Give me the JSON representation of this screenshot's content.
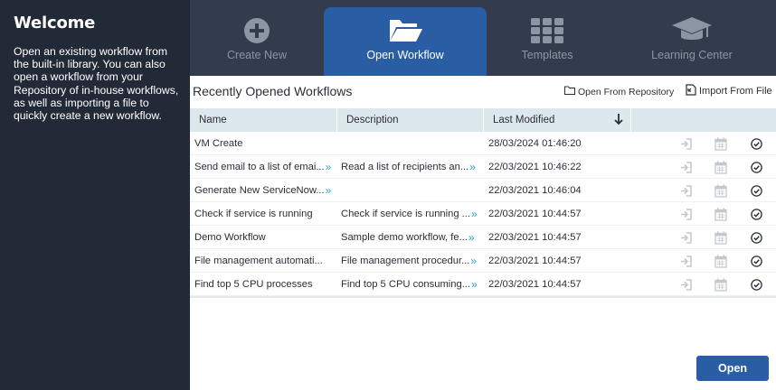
{
  "sidebar": {
    "title": "Welcome",
    "description": "Open an existing workflow from the built-in library. You can also open a workflow from your Repository of in-house workflows, as well as importing a file to quickly create a new workflow."
  },
  "tabs": [
    {
      "label": "Create New",
      "icon": "plus-circle-icon",
      "active": false
    },
    {
      "label": "Open Workflow",
      "icon": "folder-open-icon",
      "active": true
    },
    {
      "label": "Templates",
      "icon": "grid-icon",
      "active": false
    },
    {
      "label": "Learning Center",
      "icon": "graduation-cap-icon",
      "active": false
    }
  ],
  "main": {
    "heading": "Recently Opened Workflows",
    "open_from_repository": "Open From Repository",
    "import_from_file": "Import From File",
    "columns": {
      "name": "Name",
      "description": "Description",
      "last_modified": "Last Modified"
    },
    "rows": [
      {
        "name": "VM Create",
        "name_more": false,
        "description": "",
        "desc_more": false,
        "modified": "28/03/2024 01:46:20"
      },
      {
        "name": "Send email to a list of emai...",
        "name_more": true,
        "description": "Read a list of recipients an...",
        "desc_more": true,
        "modified": "22/03/2021 10:46:22"
      },
      {
        "name": "Generate New ServiceNow...",
        "name_more": true,
        "description": "",
        "desc_more": false,
        "modified": "22/03/2021 10:46:04"
      },
      {
        "name": "Check if service is running",
        "name_more": false,
        "description": "Check if service is running ...",
        "desc_more": true,
        "modified": "22/03/2021 10:44:57"
      },
      {
        "name": "Demo Workflow",
        "name_more": false,
        "description": "Sample demo workflow, fe...",
        "desc_more": true,
        "modified": "22/03/2021 10:44:57"
      },
      {
        "name": "File management automati...",
        "name_more": false,
        "description": "File management procedur...",
        "desc_more": true,
        "modified": "22/03/2021 10:44:57"
      },
      {
        "name": "Find top 5 CPU processes",
        "name_more": false,
        "description": "Find top 5 CPU consuming...",
        "desc_more": true,
        "modified": "22/03/2021 10:44:57"
      }
    ],
    "open_button": "Open"
  },
  "colors": {
    "sidebar": "#232a37",
    "topbar": "#323c4c",
    "accent": "#2a5ea4",
    "link": "#2aa3c7"
  }
}
